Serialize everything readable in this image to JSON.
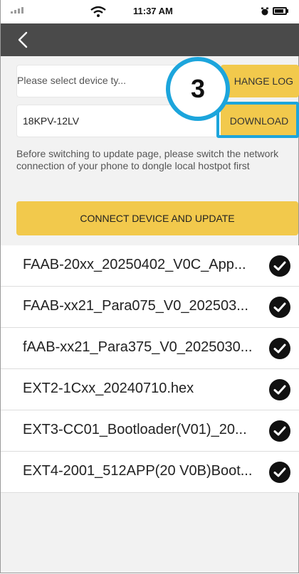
{
  "status_bar": {
    "time": "11:37 AM"
  },
  "icons": {
    "back": "chevron-left-icon",
    "wifi": "wifi-icon",
    "signal": "signal-icon",
    "alarm": "alarm-icon",
    "battery": "battery-icon",
    "check": "check-circle-icon"
  },
  "colors": {
    "nav_bg": "#4a4a4a",
    "accent_yellow": "#f2c94c",
    "highlight_blue": "#1ca5dc"
  },
  "device_select": {
    "placeholder": "Please select device ty...",
    "change_log_label": "HANGE LOG"
  },
  "model": {
    "value": "18KPV-12LV",
    "download_label": "DOWNLOAD"
  },
  "step_badge": "3",
  "instructions": "Before switching to update page, please switch the network connection of your phone to dongle local hostpot first",
  "connect_button": "CONNECT DEVICE AND UPDATE",
  "files": [
    {
      "name": "FAAB-20xx_20250402_V0C_App...",
      "checked": true
    },
    {
      "name": "FAAB-xx21_Para075_V0_202503...",
      "checked": true
    },
    {
      "name": "fAAB-xx21_Para375_V0_2025030...",
      "checked": true
    },
    {
      "name": "EXT2-1Cxx_20240710.hex",
      "checked": true
    },
    {
      "name": "EXT3-CC01_Bootloader(V01)_20...",
      "checked": true
    },
    {
      "name": "EXT4-2001_512APP(20 V0B)Boot...",
      "checked": true
    }
  ]
}
